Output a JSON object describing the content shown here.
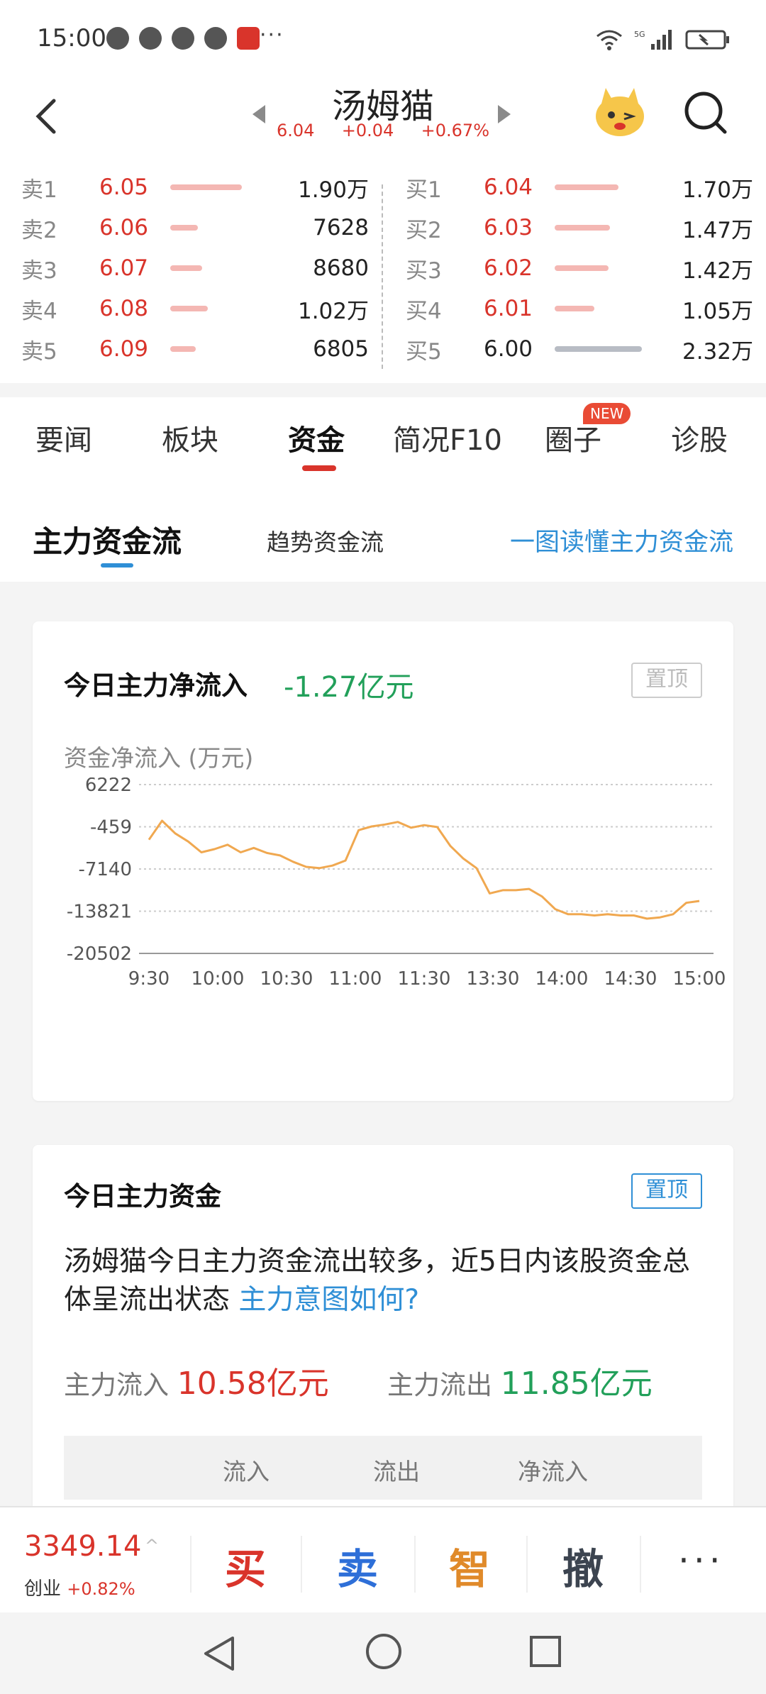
{
  "status_bar": {
    "time": "15:00",
    "more": "···"
  },
  "header": {
    "stock_name": "汤姆猫",
    "price": "6.04",
    "change": "+0.04",
    "change_pct": "+0.67%"
  },
  "order_book": {
    "sell": [
      {
        "label": "卖1",
        "price": "6.05",
        "volume": "1.90万",
        "bar": 0.72
      },
      {
        "label": "卖2",
        "price": "6.06",
        "volume": "7628",
        "bar": 0.28
      },
      {
        "label": "卖3",
        "price": "6.07",
        "volume": "8680",
        "bar": 0.32
      },
      {
        "label": "卖4",
        "price": "6.08",
        "volume": "1.02万",
        "bar": 0.38
      },
      {
        "label": "卖5",
        "price": "6.09",
        "volume": "6805",
        "bar": 0.26
      }
    ],
    "buy": [
      {
        "label": "买1",
        "price": "6.04",
        "volume": "1.70万",
        "bar": 0.64
      },
      {
        "label": "买2",
        "price": "6.03",
        "volume": "1.47万",
        "bar": 0.56
      },
      {
        "label": "买3",
        "price": "6.02",
        "volume": "1.42万",
        "bar": 0.54
      },
      {
        "label": "买4",
        "price": "6.01",
        "volume": "1.05万",
        "bar": 0.4
      },
      {
        "label": "买5",
        "price": "6.00",
        "volume": "2.32万",
        "bar": 0.88
      }
    ]
  },
  "tabs": {
    "items": [
      "要闻",
      "板块",
      "资金",
      "简况F10",
      "圈子",
      "诊股"
    ],
    "active": "资金",
    "new_badge": "NEW"
  },
  "subtabs": {
    "main": "主力资金流",
    "trend": "趋势资金流",
    "link": "一图读懂主力资金流"
  },
  "card_net": {
    "title": "今日主力净流入",
    "value": "-1.27亿元",
    "pin": "置顶",
    "unit_label": "资金净流入 (万元)"
  },
  "chart_data": {
    "type": "line",
    "ylabel": "资金净流入 (万元)",
    "y_ticks": [
      "6222",
      "-459",
      "-7140",
      "-13821",
      "-20502"
    ],
    "ylim": [
      -20502,
      6222
    ],
    "x_ticks": [
      "9:30",
      "10:00",
      "10:30",
      "11:00",
      "11:30",
      "13:30",
      "14:00",
      "14:30",
      "15:00"
    ],
    "grid": true,
    "color": "#f0a850",
    "series": [
      {
        "values": [
          -2500,
          500,
          -1500,
          -2800,
          -4500,
          -4000,
          -3300,
          -4500,
          -3800,
          -4600,
          -5000,
          -6000,
          -6800,
          -7000,
          -6600,
          -5800,
          -1000,
          -400,
          -100,
          300,
          -600,
          -200,
          -500,
          -3500,
          -5500,
          -7000,
          -11000,
          -10500,
          -10500,
          -10300,
          -11500,
          -13500,
          -14300,
          -14300,
          -14500,
          -14300,
          -14500,
          -14500,
          -15000,
          -14800,
          -14300,
          -12500,
          -12200
        ]
      }
    ]
  },
  "card_main": {
    "title": "今日主力资金",
    "pin": "置顶",
    "summary": "汤姆猫今日主力资金流出较多，近5日内该股资金总体呈流出状态",
    "summary_link": "主力意图如何?",
    "inflow_label": "主力流入",
    "inflow_value": "10.58亿元",
    "outflow_label": "主力流出",
    "outflow_value": "11.85亿元",
    "table_headers": [
      "流入",
      "流出",
      "净流入"
    ]
  },
  "trade_bar": {
    "index_value": "3349.14",
    "index_caret": "^",
    "index_name": "创业",
    "index_change": "+0.82%",
    "buy": "买",
    "sell": "卖",
    "smart": "智",
    "cancel": "撤",
    "more": "···"
  },
  "colors": {
    "up": "#d9342b",
    "down": "#22a05a",
    "link": "#2f8fd6",
    "line": "#f0a850"
  }
}
